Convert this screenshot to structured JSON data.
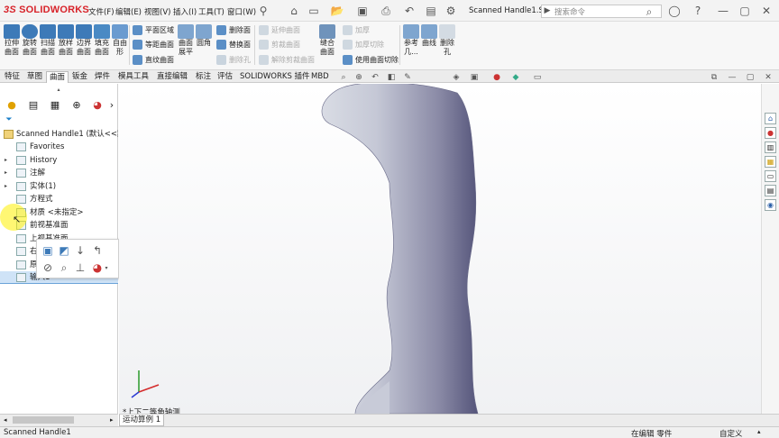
{
  "app": {
    "logo": "SOLIDWORKS",
    "document_title": "Scanned Handle1.SL..."
  },
  "menu": [
    "文件(F)",
    "编辑(E)",
    "视图(V)",
    "插入(I)",
    "工具(T)",
    "窗口(W)"
  ],
  "search": {
    "placeholder": "搜索命令"
  },
  "ribbon": {
    "large_buttons": [
      {
        "label1": "拉伸",
        "label2": "曲面",
        "color": "#3d7ab8"
      },
      {
        "label1": "旋转",
        "label2": "曲面",
        "color": "#3d7ab8"
      },
      {
        "label1": "扫描",
        "label2": "曲面",
        "color": "#3d7ab8"
      },
      {
        "label1": "放样",
        "label2": "曲面",
        "color": "#3d7ab8"
      },
      {
        "label1": "边界",
        "label2": "曲面",
        "color": "#3d7ab8"
      },
      {
        "label1": "填充",
        "label2": "曲面",
        "color": "#4a8ac4"
      },
      {
        "label1": "自由",
        "label2": "形",
        "color": "#6a9bd0"
      }
    ],
    "col1": [
      "平面区域",
      "等距曲面",
      "直纹曲面"
    ],
    "col2": {
      "label1": "曲面",
      "label2": "展平"
    },
    "col3": {
      "label": "圆角"
    },
    "col4": [
      "删除面",
      "替换面",
      "删除孔"
    ],
    "col5": [
      "延伸曲面",
      "剪裁曲面",
      "解除剪裁曲面"
    ],
    "col6": {
      "label1": "缝合",
      "label2": "曲面"
    },
    "col7": [
      "加厚",
      "加厚切除",
      "使用曲面切除"
    ],
    "col8": [
      {
        "label1": "参考",
        "label2": "几..."
      },
      {
        "label1": "曲线",
        "label2": ""
      },
      {
        "label1": "删除",
        "label2": "孔"
      }
    ]
  },
  "tabs": [
    "特征",
    "草图",
    "曲面",
    "钣金",
    "焊件",
    "模具工具",
    "直接编辑",
    "标注",
    "评估",
    "SOLIDWORKS 插件",
    "MBD"
  ],
  "active_tab": "曲面",
  "feature_tree": {
    "root": "Scanned Handle1  (默认<<默",
    "items": [
      {
        "label": "Favorites",
        "expandable": false
      },
      {
        "label": "History",
        "expandable": true
      },
      {
        "label": "注解",
        "expandable": true
      },
      {
        "label": "实体(1)",
        "expandable": true
      },
      {
        "label": "方程式",
        "expandable": false
      },
      {
        "label": "材质 <未指定>",
        "expandable": false
      },
      {
        "label": "前视基准面",
        "expandable": false
      },
      {
        "label": "上视基准面",
        "expandable": false
      },
      {
        "label": "右",
        "expandable": false
      },
      {
        "label": "原",
        "expandable": false
      },
      {
        "label": "输入1",
        "expandable": false
      }
    ]
  },
  "viewport": {
    "view_label": "*上下二等角轴测"
  },
  "bottom_tab": "运动算例 1",
  "status": {
    "left": "Scanned Handle1",
    "mode": "在编辑 零件",
    "custom": "自定义"
  }
}
